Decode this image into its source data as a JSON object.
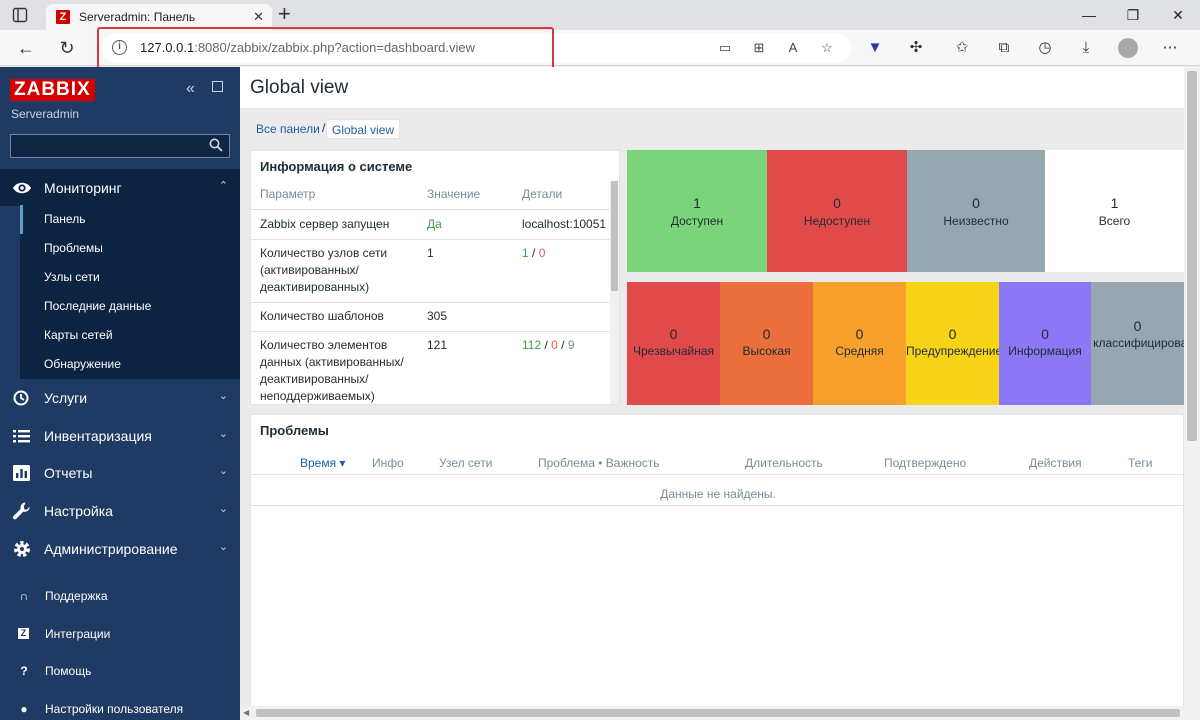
{
  "browser": {
    "tab_title": "Serveradmin: Панель",
    "tab_favicon": "Z",
    "url_host": "127.0.0.1",
    "url_rest": ":8080/zabbix/zabbix.php?action=dashboard.view",
    "icons": [
      "tab-actions-icon",
      "close-tab-icon",
      "new-tab-icon",
      "minimize-icon",
      "maximize-icon",
      "close-window-icon",
      "back-icon",
      "refresh-icon",
      "site-info-icon",
      "cast-icon",
      "apps-icon",
      "read-aloud-icon",
      "add-favorite-icon",
      "extension-v-icon",
      "extensions-icon",
      "favorites-icon",
      "collections-icon",
      "history-icon",
      "downloads-icon",
      "profile-icon",
      "more-icon"
    ]
  },
  "sidebar": {
    "logo": "ZABBIX",
    "server_name": "Serveradmin",
    "search_placeholder": "",
    "sections": [
      {
        "label": "Мониторинг",
        "icon": "eye-icon",
        "expanded": true
      },
      {
        "label": "Услуги",
        "icon": "clock-icon"
      },
      {
        "label": "Инвентаризация",
        "icon": "list-icon"
      },
      {
        "label": "Отчеты",
        "icon": "bar-chart-icon"
      },
      {
        "label": "Настройка",
        "icon": "wrench-icon"
      },
      {
        "label": "Администрирование",
        "icon": "gear-icon"
      }
    ],
    "monitoring_items": [
      "Панель",
      "Проблемы",
      "Узлы сети",
      "Последние данные",
      "Карты сетей",
      "Обнаружение"
    ],
    "footer": [
      {
        "label": "Поддержка",
        "icon": "headset-icon"
      },
      {
        "label": "Интеграции",
        "icon": "zabbix-z-icon"
      },
      {
        "label": "Помощь",
        "icon": "question-icon"
      },
      {
        "label": "Настройки пользователя",
        "icon": "user-icon"
      }
    ]
  },
  "page": {
    "title": "Global view",
    "breadcrumbs": [
      "Все панели",
      "Global view"
    ],
    "breadcrumb_sep": "/"
  },
  "system_info": {
    "title": "Информация о системе",
    "headers": [
      "Параметр",
      "Значение",
      "Детали"
    ],
    "rows": [
      {
        "param": "Zabbix сервер запущен",
        "value": "Да",
        "details": "localhost:10051"
      },
      {
        "param": "Количество узлов сети (активированных/ деактивированных)",
        "value": "1",
        "details": [
          "1",
          "0"
        ]
      },
      {
        "param": "Количество шаблонов",
        "value": "305",
        "details": []
      },
      {
        "param": "Количество элементов данных (активированных/ деактивированных/ неподдерживаемых)",
        "value": "121",
        "details": [
          "112",
          "0",
          "9"
        ]
      }
    ],
    "details_sep": " / "
  },
  "host_availability": [
    {
      "value": "1",
      "label": "Доступен",
      "color": "#7ad57a"
    },
    {
      "value": "0",
      "label": "Недоступен",
      "color": "#e14a4a"
    },
    {
      "value": "0",
      "label": "Неизвестно",
      "color": "#97a7b2"
    },
    {
      "value": "1",
      "label": "Всего",
      "color": "#ffffff"
    }
  ],
  "problems_by_severity": [
    {
      "value": "0",
      "label": "Чрезвычайная",
      "color": "#e14a4a"
    },
    {
      "value": "0",
      "label": "Высокая",
      "color": "#eb6f3c"
    },
    {
      "value": "0",
      "label": "Средняя",
      "color": "#f7a12c"
    },
    {
      "value": "0",
      "label": "Предупреждение",
      "color": "#f8d418"
    },
    {
      "value": "0",
      "label": "Информация",
      "color": "#8c77f4"
    },
    {
      "value": "0",
      "label": "Не классифицировано",
      "color": "#97a7b2"
    }
  ],
  "problems": {
    "title": "Проблемы",
    "headers": [
      "Время ▾",
      "Инфо",
      "Узел сети",
      "Проблема • Важность",
      "Длительность",
      "Подтверждено",
      "Действия",
      "Теги"
    ],
    "empty": "Данные не найдены."
  }
}
